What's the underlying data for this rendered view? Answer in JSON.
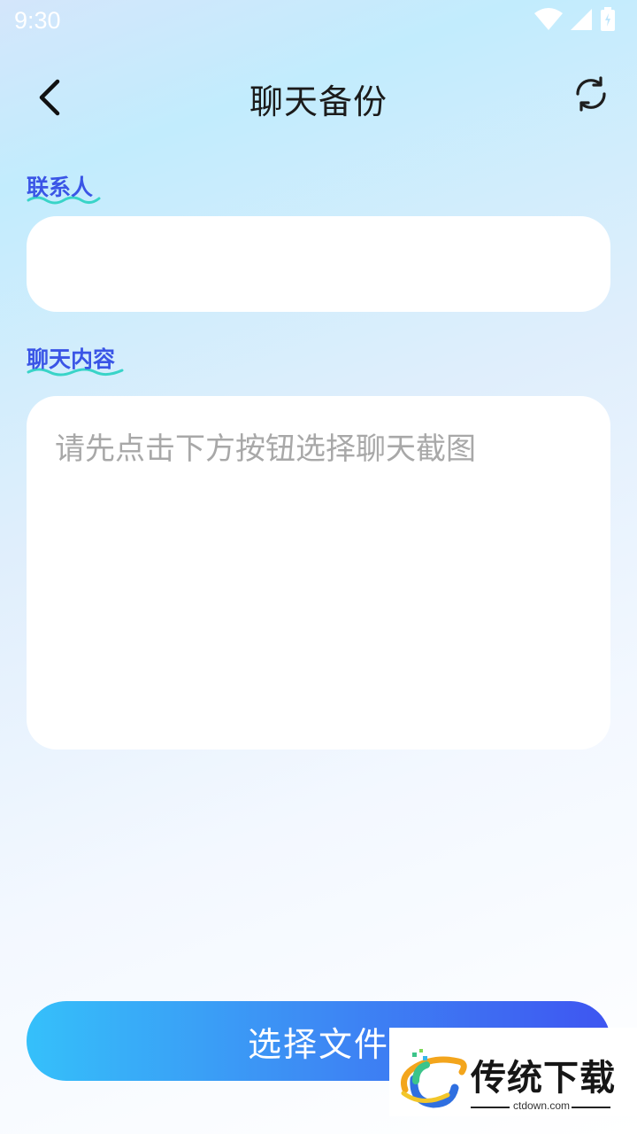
{
  "status_bar": {
    "time": "9:30",
    "icons": [
      "wifi-icon",
      "signal-icon",
      "battery-icon"
    ]
  },
  "header": {
    "title": "聊天备份",
    "back_icon": "back-arrow-icon",
    "refresh_icon": "refresh-icon"
  },
  "form": {
    "contact_label": "联系人",
    "contact_value": "",
    "contact_placeholder": "",
    "content_label": "聊天内容",
    "content_value": "",
    "content_placeholder": "请先点击下方按钮选择聊天截图"
  },
  "actions": {
    "select_file_label": "选择文件"
  },
  "watermark": {
    "brand": "传统下载",
    "url": "ctdown.com"
  },
  "colors": {
    "accent": "#3a55e6",
    "button_start": "#35c0fa",
    "button_end": "#3e55f1",
    "underline": "#39d4c8"
  }
}
